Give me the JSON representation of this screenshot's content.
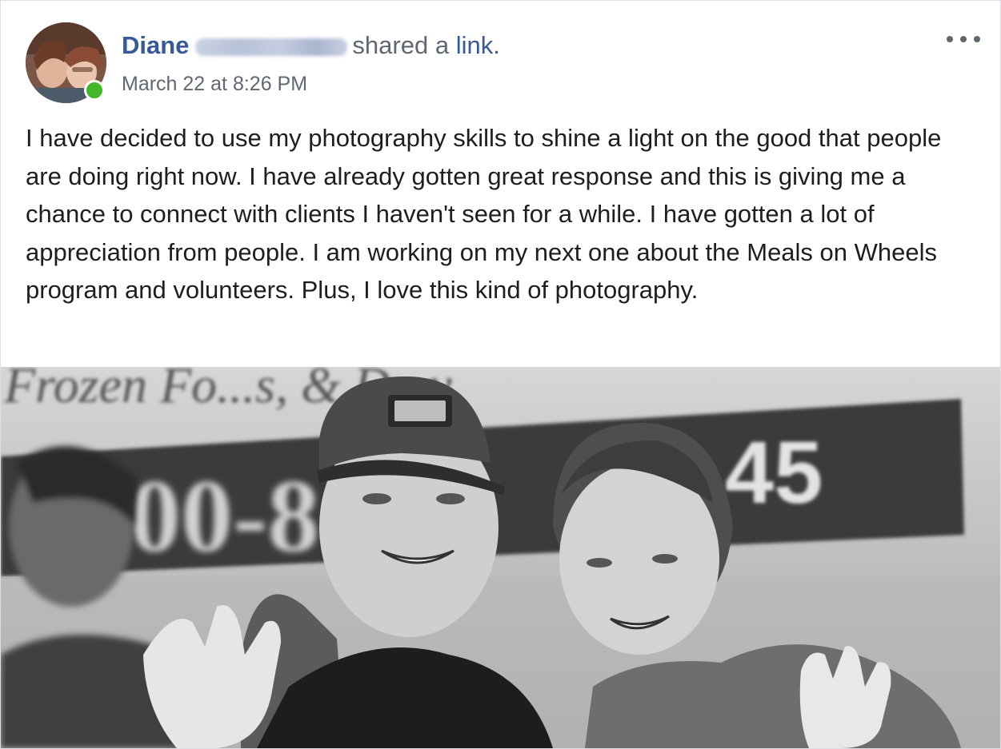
{
  "post": {
    "author_first_name": "Diane",
    "action_text": "shared a",
    "link_text": "link.",
    "timestamp": "March 22 at 8:26 PM",
    "more_icon": "more-dots-icon",
    "online_status_color": "#42b72a",
    "body": "I have decided to use my photography skills to shine a light on the good that people are doing right now. I have already gotten great response and this is giving me a chance to connect with clients I haven't seen for a while. I have gotten a lot of appreciation from people. I am working on my next one about the Meals on Wheels program and volunteers. Plus, I love this kind of photography."
  },
  "photo": {
    "banner_top_text": "Frozen Fo...s, & D...y",
    "banner_number_left": "00-8",
    "banner_number_right": "45",
    "style": "black-and-white"
  },
  "colors": {
    "link_blue": "#385898",
    "meta_gray": "#616770",
    "body_text": "#1c1e21",
    "border": "#dddfe2"
  }
}
